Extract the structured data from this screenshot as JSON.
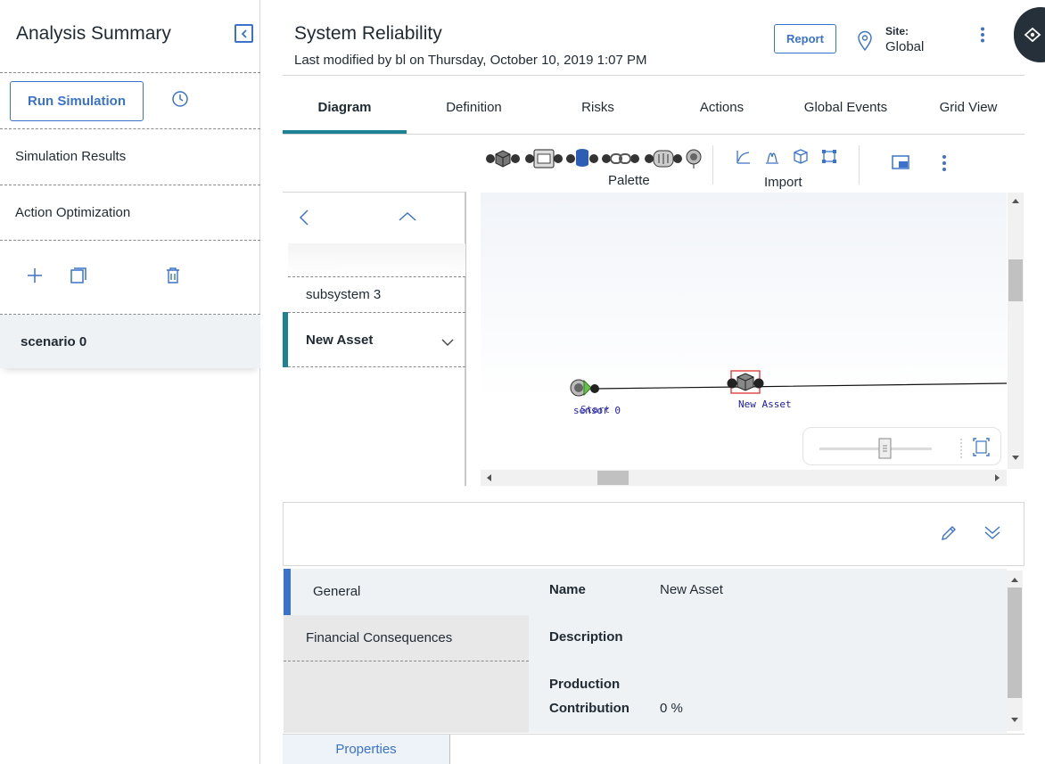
{
  "left_panel": {
    "title": "Analysis Summary",
    "run_simulation": "Run Simulation",
    "items": [
      "Simulation Results",
      "Action Optimization"
    ],
    "scenario": "scenario 0"
  },
  "header": {
    "title": "System Reliability",
    "subtitle": "Last modified by bl on Thursday, October 10, 2019 1:07 PM",
    "report": "Report",
    "site_label": "Site:",
    "site_value": "Global"
  },
  "tabs": [
    "Diagram",
    "Definition",
    "Risks",
    "Actions",
    "Global Events",
    "Grid View"
  ],
  "toolbar": {
    "palette": "Palette",
    "import": "Import"
  },
  "tree": {
    "items": [
      "subsystem 3",
      "New Asset"
    ]
  },
  "diagram": {
    "node_start": "sensor 0",
    "node_start_overlay": "Start",
    "node_asset": "New Asset"
  },
  "details": {
    "sections": [
      "General",
      "Financial Consequences"
    ],
    "props": [
      {
        "label": "Name",
        "value": "New Asset"
      },
      {
        "label": "Description",
        "value": ""
      },
      {
        "label": "Production",
        "value": ""
      },
      {
        "label": "Contribution",
        "value": "0 %"
      }
    ],
    "bottom_tab": "Properties"
  },
  "colors": {
    "accent": "#3a73c9",
    "teal": "#1c8394",
    "dark": "#26303a"
  }
}
